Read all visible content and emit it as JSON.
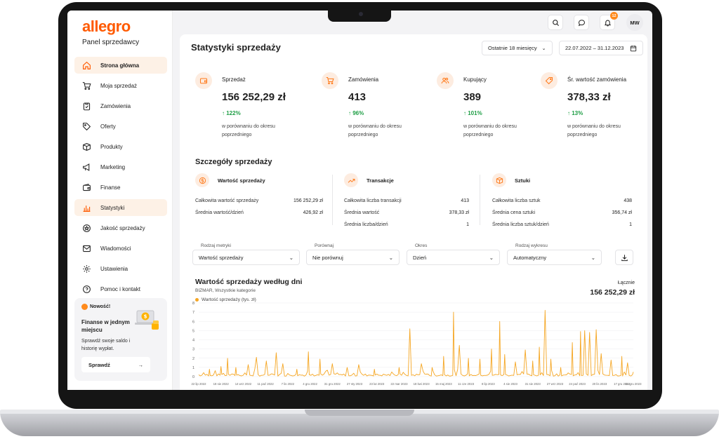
{
  "brand": {
    "logo": "allegro",
    "panel": "Panel sprzedawcy",
    "accent": "#ff5a00",
    "orange": "#ff8a1c"
  },
  "sidebar": {
    "items": [
      {
        "label": "Strona główna",
        "icon": "home-icon",
        "state": "active"
      },
      {
        "label": "Moja sprzedaż",
        "icon": "cart-icon"
      },
      {
        "label": "Zamówienia",
        "icon": "clipboard-icon"
      },
      {
        "label": "Oferty",
        "icon": "tag-icon"
      },
      {
        "label": "Produkty",
        "icon": "box-icon"
      },
      {
        "label": "Marketing",
        "icon": "megaphone-icon"
      },
      {
        "label": "Finanse",
        "icon": "wallet-icon"
      },
      {
        "label": "Statystyki",
        "icon": "bar-chart-icon",
        "state": "highlighted"
      },
      {
        "label": "Jakość sprzedaży",
        "icon": "star-badge-icon"
      },
      {
        "label": "Wiadomości",
        "icon": "mail-icon"
      },
      {
        "label": "Ustawienia",
        "icon": "gear-icon"
      },
      {
        "label": "Pomoc i kontakt",
        "icon": "help-icon"
      }
    ],
    "promo": {
      "badge": "Nowość!",
      "title": "Finanse w jednym miejscu",
      "text": "Sprawdź swoje saldo i historię wypłat.",
      "button": "Sprawdź"
    }
  },
  "topbar": {
    "avatar": "MW",
    "notifications": "12"
  },
  "page": {
    "title": "Statystyki sprzedaży",
    "period": "Ostatnie 18 miesięcy",
    "date_range": "22.07.2022 – 31.12.2023"
  },
  "kpis": [
    {
      "label": "Sprzedaż",
      "value": "156 252,29 zł",
      "delta": "122%",
      "note": "w porównaniu do okresu poprzedniego",
      "icon": "wallet-icon"
    },
    {
      "label": "Zamówienia",
      "value": "413",
      "delta": "96%",
      "note": "w porównaniu do okresu poprzedniego",
      "icon": "cart-icon"
    },
    {
      "label": "Kupujący",
      "value": "389",
      "delta": "101%",
      "note": "w porównaniu do okresu poprzedniego",
      "icon": "users-icon"
    },
    {
      "label": "Śr. wartość zamówienia",
      "value": "378,33 zł",
      "delta": "13%",
      "note": "w porównaniu do okresu poprzedniego",
      "icon": "price-tag-icon"
    }
  ],
  "details": {
    "title": "Szczegóły sprzedaży",
    "groups": [
      {
        "title": "Wartość sprzedaży",
        "icon": "coin-icon",
        "rows": [
          {
            "label": "Całkowita wartość sprzedaży",
            "value": "156 252,29 zł"
          },
          {
            "label": "Średnia wartość/dzień",
            "value": "426,92 zł"
          }
        ]
      },
      {
        "title": "Transakcje",
        "icon": "trend-icon",
        "rows": [
          {
            "label": "Całkowita liczba transakcji",
            "value": "413"
          },
          {
            "label": "Średnia wartość",
            "value": "378,33 zł"
          },
          {
            "label": "Średnia liczba/dzień",
            "value": "1"
          }
        ]
      },
      {
        "title": "Sztuki",
        "icon": "box-icon",
        "rows": [
          {
            "label": "Całkowita liczba sztuk",
            "value": "438"
          },
          {
            "label": "Średnia cena sztuki",
            "value": "356,74 zł"
          },
          {
            "label": "Średnia liczba sztuk/dzień",
            "value": "1"
          }
        ]
      }
    ]
  },
  "filters": [
    {
      "label": "Rodzaj metryki",
      "value": "Wartość sprzedaży"
    },
    {
      "label": "Porównaj",
      "value": "Nie porównuj"
    },
    {
      "label": "Okres",
      "value": "Dzień"
    },
    {
      "label": "Rodzaj wykresu",
      "value": "Automatyczny"
    }
  ],
  "chart": {
    "title": "Wartość sprzedaży według dni",
    "subtitle": "BIZMAR, Wszystkie kategorie",
    "legend": "Wartość sprzedaży (tys. zł)",
    "total_label": "Łącznie",
    "total_value": "156 252,29 zł"
  },
  "chart_data": {
    "type": "line",
    "series": [
      {
        "name": "Wartość sprzedaży (tys. zł)",
        "color": "#f5a623"
      }
    ],
    "ylim": [
      0,
      8
    ],
    "yticks": [
      "0",
      "1",
      "2",
      "3",
      "4",
      "5",
      "6",
      "7",
      "8"
    ],
    "xticks": [
      "22 lip 2022",
      "18 sie 2022",
      "14 wrz 2022",
      "11 paź 2022",
      "7 lis 2022",
      "4 gru 2022",
      "31 gru 2022",
      "27 sty 2023",
      "23 lut 2023",
      "22 mar 2023",
      "18 kwi 2023",
      "15 maj 2023",
      "11 cze 2023",
      "8 lip 2023",
      "4 sie 2023",
      "31 sie 2023",
      "27 wrz 2023",
      "24 paź 2023",
      "20 lis 2023",
      "17 gru 2023",
      "31 gru 2023"
    ],
    "peaks": [
      {
        "x": "22 lip 2022",
        "y": 0.2
      },
      {
        "x": "4 sie 2022",
        "y": 0.8
      },
      {
        "x": "18 sie 2022",
        "y": 1.1
      },
      {
        "x": "26 sie 2022",
        "y": 2.0
      },
      {
        "x": "5 wrz 2022",
        "y": 1.0
      },
      {
        "x": "20 wrz 2022",
        "y": 1.3
      },
      {
        "x": "30 wrz 2022",
        "y": 2.1
      },
      {
        "x": "12 paź 2022",
        "y": 1.7
      },
      {
        "x": "24 paź 2022",
        "y": 2.6
      },
      {
        "x": "1 lis 2022",
        "y": 1.4
      },
      {
        "x": "18 lis 2022",
        "y": 0.8
      },
      {
        "x": "2 gru 2022",
        "y": 2.7
      },
      {
        "x": "16 gru 2022",
        "y": 1.9
      },
      {
        "x": "31 gru 2022",
        "y": 1.4
      },
      {
        "x": "18 sty 2023",
        "y": 1.0
      },
      {
        "x": "1 lut 2023",
        "y": 1.3
      },
      {
        "x": "20 lut 2023",
        "y": 0.8
      },
      {
        "x": "22 mar 2023",
        "y": 1.0
      },
      {
        "x": "4 kwi 2023",
        "y": 5.2
      },
      {
        "x": "18 kwi 2023",
        "y": 1.4
      },
      {
        "x": "1 maj 2023",
        "y": 1.0
      },
      {
        "x": "15 maj 2023",
        "y": 2.2
      },
      {
        "x": "27 maj 2023",
        "y": 7.0
      },
      {
        "x": "3 cze 2023",
        "y": 3.4
      },
      {
        "x": "14 cze 2023",
        "y": 2.0
      },
      {
        "x": "28 cze 2023",
        "y": 1.9
      },
      {
        "x": "12 lip 2023",
        "y": 3.0
      },
      {
        "x": "22 lip 2023",
        "y": 6.0
      },
      {
        "x": "28 lip 2023",
        "y": 2.4
      },
      {
        "x": "10 sie 2023",
        "y": 1.6
      },
      {
        "x": "22 sie 2023",
        "y": 2.9
      },
      {
        "x": "31 sie 2023",
        "y": 1.7
      },
      {
        "x": "8 wrz 2023",
        "y": 3.2
      },
      {
        "x": "15 wrz 2023",
        "y": 7.2
      },
      {
        "x": "22 wrz 2023",
        "y": 1.9
      },
      {
        "x": "4 paź 2023",
        "y": 1.0
      },
      {
        "x": "18 paź 2023",
        "y": 3.7
      },
      {
        "x": "28 paź 2023",
        "y": 4.9
      },
      {
        "x": "2 lis 2023",
        "y": 5.0
      },
      {
        "x": "8 lis 2023",
        "y": 4.8
      },
      {
        "x": "16 lis 2023",
        "y": 5.1
      },
      {
        "x": "22 lis 2023",
        "y": 2.5
      },
      {
        "x": "4 gru 2023",
        "y": 1.8
      },
      {
        "x": "17 gru 2023",
        "y": 2.2
      },
      {
        "x": "24 gru 2023",
        "y": 1.5
      },
      {
        "x": "31 gru 2023",
        "y": 0.5
      }
    ]
  }
}
